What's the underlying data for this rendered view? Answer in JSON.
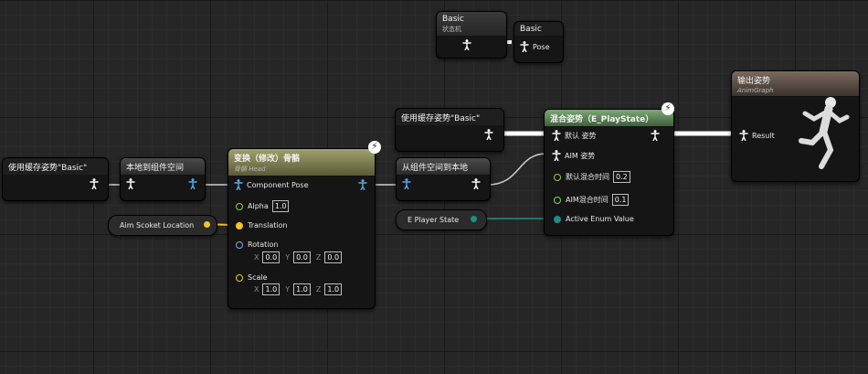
{
  "colors": {
    "exec_white": "#ffffff",
    "pose_blue": "#5aa9e6",
    "vector_yellow": "#f4c430",
    "rotator_blue": "#8fa6e8",
    "float_green": "#8ccf4e",
    "enum_teal": "#1b8f86"
  },
  "nodes": {
    "state_machine": {
      "title": "Basic",
      "subtitle": "状态机"
    },
    "basic_pose": {
      "title": "Basic",
      "pin": "Pose"
    },
    "cached_pose_left": {
      "title": "使用缓存姿势\"Basic\""
    },
    "local_to_component": {
      "title": "本地到组件空间"
    },
    "transform_bone": {
      "title": "变换（修改）骨骼",
      "subtitle": "骨骼 Head",
      "pins": {
        "component_pose": "Component Pose",
        "alpha": "Alpha",
        "alpha_value": "1.0",
        "translation": "Translation",
        "rotation": "Rotation",
        "scale": "Scale"
      },
      "rotation_values": {
        "x_label": "X",
        "x": "0.0",
        "y_label": "Y",
        "y": "0.0",
        "z_label": "Z",
        "z": "0.0"
      },
      "scale_values": {
        "x_label": "X",
        "x": "1.0",
        "y_label": "Y",
        "y": "1.0",
        "z_label": "Z",
        "z": "1.0"
      }
    },
    "aim_socket": {
      "label": "Aim Scoket Location"
    },
    "component_to_local": {
      "title": "从组件空间到本地"
    },
    "cached_pose_mid": {
      "title": "使用缓存姿势\"Basic\""
    },
    "player_state": {
      "label": "E Player State"
    },
    "blend_pose": {
      "title": "混合姿势（E_PlayState）",
      "pins": {
        "default_pose": "默认 姿势",
        "aim_pose": "AIM 姿势",
        "default_blend_time": "默认混合时间",
        "default_blend_value": "0.2",
        "aim_blend_time": "AIM混合时间",
        "aim_blend_value": "0.1",
        "active_enum": "Active Enum Value"
      }
    },
    "output_pose": {
      "title": "输出姿势",
      "subtitle": "AnimGraph",
      "pin": "Result"
    }
  }
}
